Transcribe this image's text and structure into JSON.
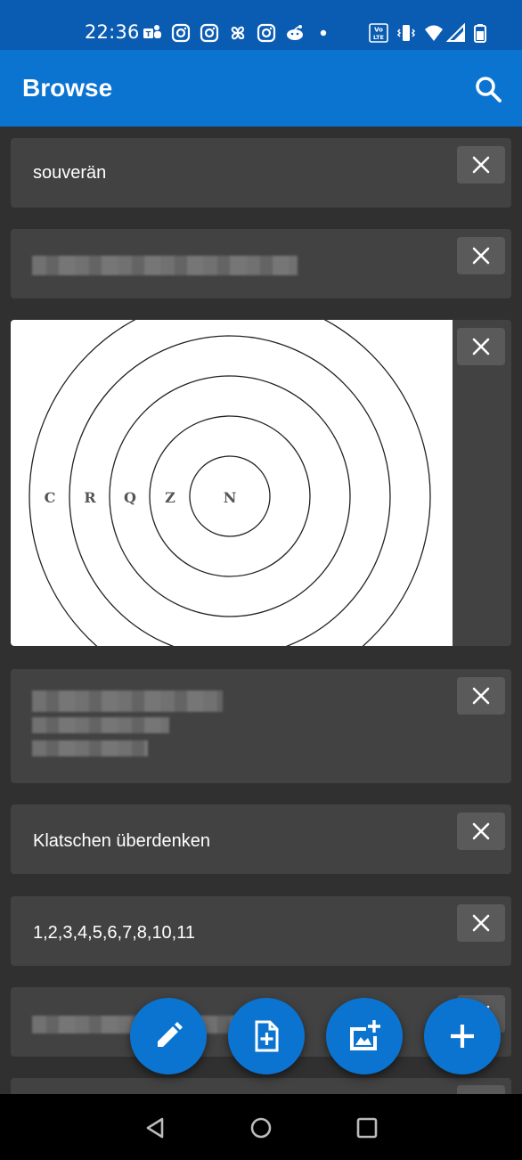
{
  "status_bar": {
    "time": "22:36",
    "icons": [
      "teams-icon",
      "instagram-icon",
      "instagram-icon",
      "pinwheel-icon",
      "instagram-icon",
      "reddit-icon",
      "dot-icon",
      "volte-icon",
      "vibrate-icon",
      "wifi-icon",
      "signal-icon",
      "battery-icon"
    ]
  },
  "app_bar": {
    "title": "Browse",
    "search_icon": "search-icon"
  },
  "cards": [
    {
      "type": "text",
      "text": "souverän"
    },
    {
      "type": "blurred"
    },
    {
      "type": "image",
      "image": {
        "letters": [
          "C",
          "R",
          "Q",
          "Z",
          "N"
        ]
      }
    },
    {
      "type": "blurred"
    },
    {
      "type": "text",
      "text": "Klatschen überdenken"
    },
    {
      "type": "text",
      "text": "1,2,3,4,5,6,7,8,10,11"
    },
    {
      "type": "blurred"
    }
  ],
  "fabs": [
    {
      "icon": "pencil-icon"
    },
    {
      "icon": "new-file-icon"
    },
    {
      "icon": "add-image-icon"
    },
    {
      "icon": "plus-icon"
    }
  ],
  "nav_bar": {
    "icons": [
      "back-icon",
      "home-icon",
      "recents-icon"
    ]
  },
  "colors": {
    "app_bar": "#0b74d1",
    "status_bar": "#0a5cb3",
    "background": "#303030",
    "card": "#424242",
    "close_button": "#5a5a5a",
    "fab": "#0b74d1"
  }
}
